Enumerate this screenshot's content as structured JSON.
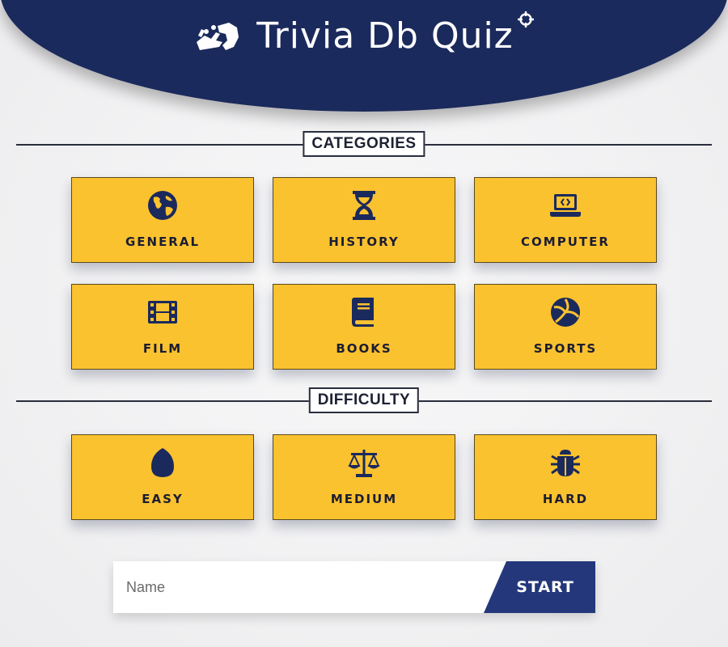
{
  "header": {
    "title": "Trivia Db Quiz",
    "brand_icon": "sign-language-hands-icon",
    "title_icon": "crosshairs-icon",
    "background_color": "#1b2a5c"
  },
  "categories": {
    "heading": "CATEGORIES",
    "items": [
      {
        "label": "GENERAL",
        "icon": "globe-icon"
      },
      {
        "label": "HISTORY",
        "icon": "hourglass-icon"
      },
      {
        "label": "COMPUTER",
        "icon": "laptop-code-icon"
      },
      {
        "label": "FILM",
        "icon": "film-icon"
      },
      {
        "label": "BOOKS",
        "icon": "book-icon"
      },
      {
        "label": "SPORTS",
        "icon": "volleyball-icon"
      }
    ]
  },
  "difficulty": {
    "heading": "DIFFICULTY",
    "items": [
      {
        "label": "EASY",
        "icon": "egg-icon"
      },
      {
        "label": "MEDIUM",
        "icon": "balance-scale-icon"
      },
      {
        "label": "HARD",
        "icon": "bug-icon"
      }
    ]
  },
  "form": {
    "name_placeholder": "Name",
    "name_value": "",
    "start_label": "START"
  },
  "colors": {
    "card": "#fbc22f",
    "navy": "#1b2a5c",
    "start": "#24377a"
  }
}
